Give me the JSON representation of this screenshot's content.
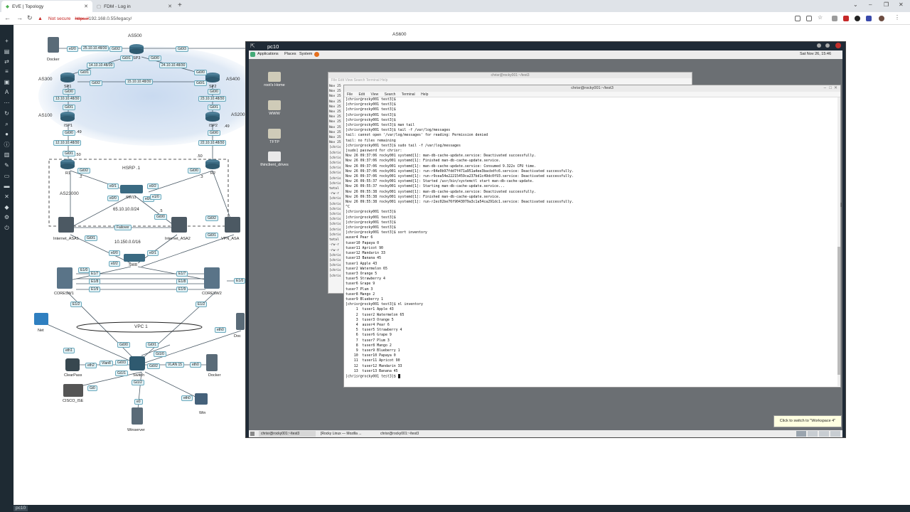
{
  "browser": {
    "tabs": [
      {
        "label": "EVE | Topology",
        "active": true
      },
      {
        "label": "FDM - Log in",
        "active": false
      }
    ],
    "address": {
      "not_secure": "Not secure",
      "scheme": "https://",
      "host_path": "192.168.0.55/legacy/"
    }
  },
  "topology": {
    "as_labels": [
      "AS500",
      "AS600",
      "AS300",
      "AS400",
      "AS100",
      "AS200",
      "AS23000"
    ],
    "hsrp_label": "HSRP .1",
    "vpc_label": "VPC 1",
    "nodes": {
      "docker1": "Docker",
      "sp3": "SP3",
      "sp1": "SP1",
      "sp2": "SP2",
      "isp1": "ISP1",
      "isp2": "ISP2",
      "r1": "R1",
      "r2": "R2",
      "sw11": "SW11",
      "asa1": "Internet_ASA1",
      "asa2": "Internet_ASA2",
      "vpn_asa": "VPN_ASA",
      "sw8": "SW8",
      "coresw1": "CORESW1",
      "coresw2": "CORESW2",
      "net": "Net",
      "switch": "Switch",
      "clearpass": "ClearPass",
      "docker2": "Docker",
      "ise": "CISCO_ISE",
      "win": "Win",
      "winserver": "Winserver",
      "doc_right": "Doc"
    },
    "links": {
      "l1": "25.10.10.48/30",
      "l2": "14.10.10.48/30",
      "l3": "15.10.10.48/30",
      "l4": "24.10.10.48/30",
      "l5": "13.10.10.48/30",
      "l6": "23.10.10.48/30",
      "l7": "12.10.10.48/30",
      "l8": "22.10.10.48/30",
      "net1": "65.10.10.0/24",
      "net2": "10.150.0.0/16",
      "failover": "Failover",
      "vlan15": "VLAN 15",
      "vlanx": "Vlan8"
    },
    "ips": {
      "isp1": ".49",
      "isp2": ".49",
      "r1a": ".50",
      "r2a": ".50",
      "r1b": ".2",
      "r2b": ".3",
      "sw5": ".5"
    },
    "ports": [
      "e0/0",
      "Gi0/2",
      "Gi0/3",
      "Gi0/1",
      "Gi0/0",
      "Gi0/1",
      "Gi0/2",
      "Gi0/0",
      "Gi0/1",
      "Gi0/0",
      "Gi0/1",
      "Gi0/0",
      "Gi0/1",
      "Gi0/0",
      "Gi0/1",
      "Gi0/2",
      "Gi0/0",
      "e0/1",
      "e0/2",
      "e0/3",
      "e1/0",
      "e0/0",
      "Gi0/0",
      "Gi0/2",
      "Gi0/0",
      "Gi0/1",
      "Gi0/1",
      "e0/0",
      "e0/1",
      "e0/2",
      "E1/7",
      "E1/7",
      "E1/8",
      "E1/8",
      "E1/9",
      "E1/9",
      "E1/0",
      "E1/2",
      "E1/2",
      "E1/0",
      "Gi0/0",
      "Gi0/1",
      "Gi1/0",
      "Gi0/3",
      "Gi1/1",
      "Gi0/2",
      "Gi1/2",
      "eth0",
      "eth0",
      "eth1",
      "eth2",
      "Gi0",
      "e0",
      "eth0"
    ]
  },
  "vm": {
    "title": "pc10",
    "gnome_menu": [
      "Applications",
      "Places",
      "System"
    ],
    "clock": "Sat Nov 26, 15:46",
    "desktop_icons": [
      "root's Home",
      "WWW",
      "TFTP",
      "thinclient_drives"
    ],
    "back_terminal": {
      "title": "chrisr@rocky001:~/test3",
      "menu": [
        "File",
        "Edit",
        "View",
        "Search",
        "Terminal",
        "Help"
      ],
      "lines": [
        "Nov 25",
        "Nov 25",
        "Nov 25",
        "Nov 25",
        "Nov 25",
        "Nov 25",
        "Nov 25",
        "Nov 25",
        "Nov 25",
        "Nov 25",
        "Nov 25",
        "Nov 25",
        "[chris",
        "[chris",
        "[chris",
        "[chris",
        "[chris",
        "[chris",
        "[chris",
        "[chris",
        "total",
        "-rw-r",
        "[chris",
        "[chris",
        "[chris",
        "[chris",
        "[chris",
        "[chris",
        "[chris",
        "[chris",
        "total",
        "-rw-r",
        "-rw-r",
        "[chris",
        "[chris",
        "[chris",
        "[chris",
        "[chris"
      ]
    },
    "terminal": {
      "title": "chrisr@rocky001:~/test3",
      "menu": [
        "File",
        "Edit",
        "View",
        "Search",
        "Terminal",
        "Help"
      ],
      "lines": [
        "[chrisr@rocky001 test3]$",
        "[chrisr@rocky001 test3]$",
        "[chrisr@rocky001 test3]$",
        "[chrisr@rocky001 test3]$",
        "[chrisr@rocky001 test3]$",
        "[chrisr@rocky001 test3]$ man tail",
        "[chrisr@rocky001 test3]$ tail -f /var/log/messages",
        "tail: cannot open '/var/log/messages' for reading: Permission denied",
        "tail: no files remaining",
        "[chrisr@rocky001 test3]$ sudo tail -f /var/log/messages",
        "[sudo] password for chrisr:",
        "Nov 26 09:37:06 rocky001 systemd[1]: man-db-cache-update.service: Deactivated successfully.",
        "Nov 26 09:37:06 rocky001 systemd[1]: Finished man-db-cache-update.service.",
        "Nov 26 09:37:06 rocky001 systemd[1]: man-db-cache-update.service: Consumed 9.322s CPU time.",
        "Nov 26 09:37:06 rocky001 systemd[1]: run-r84e0b97fdd7f471a951a4ee3bacbdfc6.service: Deactivated successfully.",
        "Nov 26 09:37:06 rocky001 systemd[1]: run-r9cea54e22215459ca237bd1c49dc0f93.service: Deactivated successfully.",
        "Nov 26 09:55:37 rocky001 systemd[1]: Started /usr/bin/systemctl start man-db-cache-update.",
        "Nov 26 09:55:37 rocky001 systemd[1]: Starting man-db-cache-update.service...",
        "Nov 26 09:55:38 rocky001 systemd[1]: man-db-cache-update.service: Deactivated successfully.",
        "Nov 26 09:55:38 rocky001 systemd[1]: Finished man-db-cache-update.service.",
        "Nov 26 09:55:38 rocky001 systemd[1]: run-r2ec02be76f9043079a3c1a54ca291dc1.service: Deactivated successfully.",
        "^C",
        "[chrisr@rocky001 test3]$",
        "[chrisr@rocky001 test3]$",
        "[chrisr@rocky001 test3]$",
        "[chrisr@rocky001 test3]$",
        "[chrisr@rocky001 test3]$ sort inventory",
        "auser4 Pear 6",
        "tuser10 Papaya 0",
        "tuser11 Apricot 90",
        "tuser12 Mandarin 33",
        "tuser13 Banana 45",
        "tuser1 Apple 43",
        "tuser2 Watermelon 65",
        "tuser3 Orange 5",
        "tuser5 Strawberry 4",
        "tuser6 Grape 9",
        "tuser7 Plum 3",
        "tuser8 Mango 2",
        "tuser9 Blueberry 1",
        "[chrisr@rocky001 test3]$ nl inventory",
        "     1  tuser1 Apple 43",
        "     2  tuser2 Watermelon 65",
        "     3  tuser3 Orange 5",
        "     4  auser4 Pear 6",
        "     5  tuser5 Strawberry 4",
        "     6  tuser6 Grape 9",
        "     7  tuser7 Plum 3",
        "     8  tuser8 Mango 2",
        "     9  tuser9 Blueberry 1",
        "    10  tuser10 Papaya 0",
        "    11  tuser11 Apricot 90",
        "    12  tuser12 Mandarin 33",
        "    13  tuser13 Banana 45"
      ],
      "prompt": "[chrisr@rocky001 test3]$ "
    },
    "taskbar": [
      "chrisr@rocky001:~/test3",
      "[Rocky Linux — Mozilla ...",
      "chrisr@rocky001:~/test3"
    ],
    "tooltip": "Click to switch to \"Workspace 4\""
  },
  "eve_bottom_tab": "pc10"
}
